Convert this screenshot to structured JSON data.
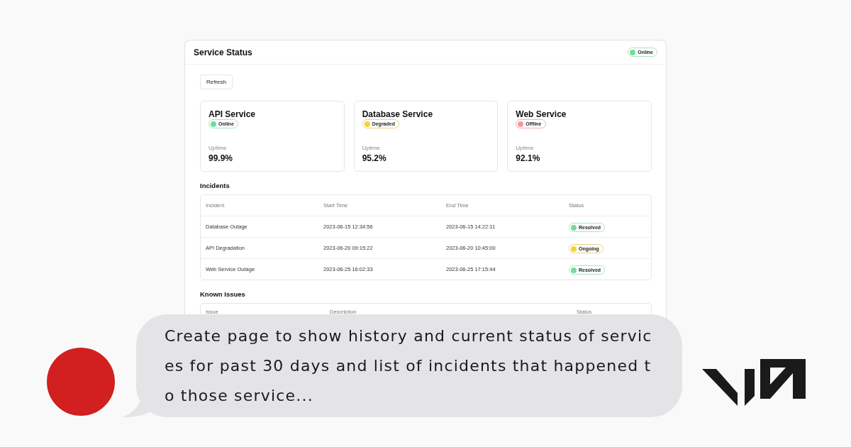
{
  "window": {
    "title": "Service Status",
    "status": {
      "label": "Online",
      "kind": "online"
    }
  },
  "refresh_button": "Refresh",
  "services": [
    {
      "name": "API Service",
      "status": {
        "label": "Online",
        "kind": "online"
      },
      "uptime_label": "Uptime",
      "uptime": "99.9%"
    },
    {
      "name": "Database Service",
      "status": {
        "label": "Degraded",
        "kind": "degraded"
      },
      "uptime_label": "Uptime",
      "uptime": "95.2%"
    },
    {
      "name": "Web Service",
      "status": {
        "label": "Offline",
        "kind": "offline"
      },
      "uptime_label": "Uptime",
      "uptime": "92.1%"
    }
  ],
  "incidents": {
    "title": "Incidents",
    "columns": [
      "Incident",
      "Start Time",
      "End Time",
      "Status"
    ],
    "rows": [
      {
        "incident": "Database Outage",
        "start": "2023-06-15 12:34:56",
        "end": "2023-06-15 14:22:11",
        "status": {
          "label": "Resolved",
          "kind": "resolved"
        }
      },
      {
        "incident": "API Degradation",
        "start": "2023-06-20 09:15:22",
        "end": "2023-06-20 10:45:00",
        "status": {
          "label": "Ongoing",
          "kind": "ongoing"
        }
      },
      {
        "incident": "Web Service Outage",
        "start": "2023-06-25 16:02:33",
        "end": "2023-06-25 17:15:44",
        "status": {
          "label": "Resolved",
          "kind": "resolved"
        }
      }
    ]
  },
  "known_issues": {
    "title": "Known Issues",
    "columns": [
      "Issue",
      "Description",
      "Status"
    ]
  },
  "chat": {
    "message": "Create page to show history and current status of services for past 30 days and list of incidents that happened to those service..."
  }
}
